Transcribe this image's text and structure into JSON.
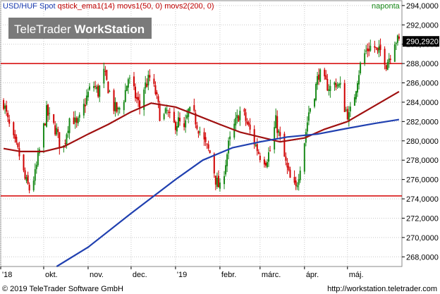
{
  "header": {
    "symbol": "USD/HUF Spot",
    "indicators": "qstick_ema1(14) movs1(50, 0) movs2(200, 0)",
    "interval": "naponta"
  },
  "watermark": {
    "brand": "TeleTrader",
    "product": "WorkStation"
  },
  "footer": {
    "copyright": "© 2019 TeleTrader Software GmbH",
    "url": "http://workstation.teletrader.com"
  },
  "chart_data": {
    "type": "candlestick",
    "ylim": [
      267000,
      294500
    ],
    "y_ticks": [
      268000,
      270000,
      272000,
      274000,
      276000,
      278000,
      280000,
      282000,
      284000,
      286000,
      288000,
      290000,
      292000,
      294000
    ],
    "y_tick_labels": [
      "268,0000",
      "270,0000",
      "272,0000",
      "274,0000",
      "276,0000",
      "278,0000",
      "280,0000",
      "282,0000",
      "284,0000",
      "286,0000",
      "288,0000",
      "290,0000",
      "292,0000",
      "294,0000"
    ],
    "x_range": [
      "2018-09-01",
      "2019-06-08"
    ],
    "x_ticks": [
      {
        "date": "2018-09-01",
        "label": "'18"
      },
      {
        "date": "2018-10-01",
        "label": "okt."
      },
      {
        "date": "2018-11-01",
        "label": "nov."
      },
      {
        "date": "2018-12-01",
        "label": "dec."
      },
      {
        "date": "2019-01-01",
        "label": "'19"
      },
      {
        "date": "2019-02-01",
        "label": "febr."
      },
      {
        "date": "2019-03-01",
        "label": "márc."
      },
      {
        "date": "2019-04-01",
        "label": "ápr."
      },
      {
        "date": "2019-05-01",
        "label": "máj."
      }
    ],
    "last_price": 290292,
    "last_price_label": "290,2920",
    "horizontal_lines": [
      {
        "value": 288000,
        "color": "#d40000"
      },
      {
        "value": 274300,
        "color": "#d40000"
      }
    ],
    "close_path": [
      [
        "2018-09-03",
        284000
      ],
      [
        "2018-09-06",
        282000
      ],
      [
        "2018-09-10",
        280000
      ],
      [
        "2018-09-14",
        278500
      ],
      [
        "2018-09-18",
        276000
      ],
      [
        "2018-09-21",
        275000
      ],
      [
        "2018-09-25",
        276500
      ],
      [
        "2018-09-28",
        279000
      ],
      [
        "2018-10-03",
        283000
      ],
      [
        "2018-10-06",
        282000
      ],
      [
        "2018-10-10",
        281000
      ],
      [
        "2018-10-14",
        278500
      ],
      [
        "2018-10-17",
        281000
      ],
      [
        "2018-10-20",
        283000
      ],
      [
        "2018-10-24",
        281500
      ],
      [
        "2018-10-27",
        282500
      ],
      [
        "2018-10-31",
        284500
      ],
      [
        "2018-11-04",
        286000
      ],
      [
        "2018-11-08",
        285000
      ],
      [
        "2018-11-12",
        287000
      ],
      [
        "2018-11-15",
        285500
      ],
      [
        "2018-11-19",
        283500
      ],
      [
        "2018-11-22",
        283000
      ],
      [
        "2018-11-26",
        284500
      ],
      [
        "2018-11-29",
        286500
      ],
      [
        "2018-12-03",
        285000
      ],
      [
        "2018-12-07",
        283500
      ],
      [
        "2018-12-10",
        285500
      ],
      [
        "2018-12-14",
        286500
      ],
      [
        "2018-12-18",
        285000
      ],
      [
        "2018-12-22",
        282000
      ],
      [
        "2018-12-26",
        283000
      ],
      [
        "2018-12-30",
        281500
      ],
      [
        "2019-01-03",
        282000
      ],
      [
        "2019-01-07",
        281000
      ],
      [
        "2019-01-10",
        283000
      ],
      [
        "2019-01-14",
        282500
      ],
      [
        "2019-01-18",
        281000
      ],
      [
        "2019-01-22",
        279500
      ],
      [
        "2019-01-26",
        278500
      ],
      [
        "2019-01-29",
        276000
      ],
      [
        "2019-02-01",
        275000
      ],
      [
        "2019-02-04",
        277000
      ],
      [
        "2019-02-07",
        279500
      ],
      [
        "2019-02-11",
        281500
      ],
      [
        "2019-02-15",
        283000
      ],
      [
        "2019-02-18",
        282500
      ],
      [
        "2019-02-22",
        281000
      ],
      [
        "2019-02-26",
        279500
      ],
      [
        "2019-03-01",
        278500
      ],
      [
        "2019-03-05",
        278000
      ],
      [
        "2019-03-08",
        279000
      ],
      [
        "2019-03-12",
        282000
      ],
      [
        "2019-03-16",
        279500
      ],
      [
        "2019-03-20",
        277000
      ],
      [
        "2019-03-23",
        275500
      ],
      [
        "2019-03-26",
        275000
      ],
      [
        "2019-03-29",
        277500
      ],
      [
        "2019-04-01",
        280000
      ],
      [
        "2019-04-04",
        283000
      ],
      [
        "2019-04-08",
        285000
      ],
      [
        "2019-04-11",
        287000
      ],
      [
        "2019-04-15",
        286000
      ],
      [
        "2019-04-19",
        285500
      ],
      [
        "2019-04-23",
        286000
      ],
      [
        "2019-04-26",
        285500
      ],
      [
        "2019-04-29",
        283500
      ],
      [
        "2019-05-02",
        282500
      ],
      [
        "2019-05-05",
        284000
      ],
      [
        "2019-05-08",
        286500
      ],
      [
        "2019-05-11",
        288500
      ],
      [
        "2019-05-15",
        289500
      ],
      [
        "2019-05-19",
        290000
      ],
      [
        "2019-05-22",
        289000
      ],
      [
        "2019-05-25",
        289500
      ],
      [
        "2019-05-28",
        288000
      ],
      [
        "2019-05-31",
        289000
      ],
      [
        "2019-06-03",
        290500
      ],
      [
        "2019-06-06",
        290292
      ]
    ],
    "series": [
      {
        "color": "#a01010",
        "points": [
          [
            "2018-09-03",
            279200
          ],
          [
            "2018-09-15",
            278900
          ],
          [
            "2018-10-01",
            278900
          ],
          [
            "2018-10-15",
            279400
          ],
          [
            "2018-11-01",
            280700
          ],
          [
            "2018-11-15",
            281700
          ],
          [
            "2018-12-01",
            283000
          ],
          [
            "2018-12-15",
            283900
          ],
          [
            "2019-01-01",
            283500
          ],
          [
            "2019-01-15",
            282700
          ],
          [
            "2019-02-01",
            281700
          ],
          [
            "2019-02-15",
            280900
          ],
          [
            "2019-03-01",
            280400
          ],
          [
            "2019-03-15",
            279900
          ],
          [
            "2019-04-01",
            280300
          ],
          [
            "2019-04-15",
            281200
          ],
          [
            "2019-05-01",
            282000
          ],
          [
            "2019-05-15",
            283200
          ],
          [
            "2019-06-06",
            285100
          ]
        ]
      },
      {
        "color": "#2040b0",
        "points": [
          [
            "2018-10-10",
            267000
          ],
          [
            "2018-11-01",
            269000
          ],
          [
            "2018-12-01",
            272500
          ],
          [
            "2019-01-01",
            276000
          ],
          [
            "2019-01-20",
            278000
          ],
          [
            "2019-02-10",
            279300
          ],
          [
            "2019-03-01",
            279900
          ],
          [
            "2019-03-20",
            280400
          ],
          [
            "2019-04-10",
            280700
          ],
          [
            "2019-05-01",
            281300
          ],
          [
            "2019-05-20",
            281800
          ],
          [
            "2019-06-06",
            282200
          ]
        ]
      }
    ]
  }
}
